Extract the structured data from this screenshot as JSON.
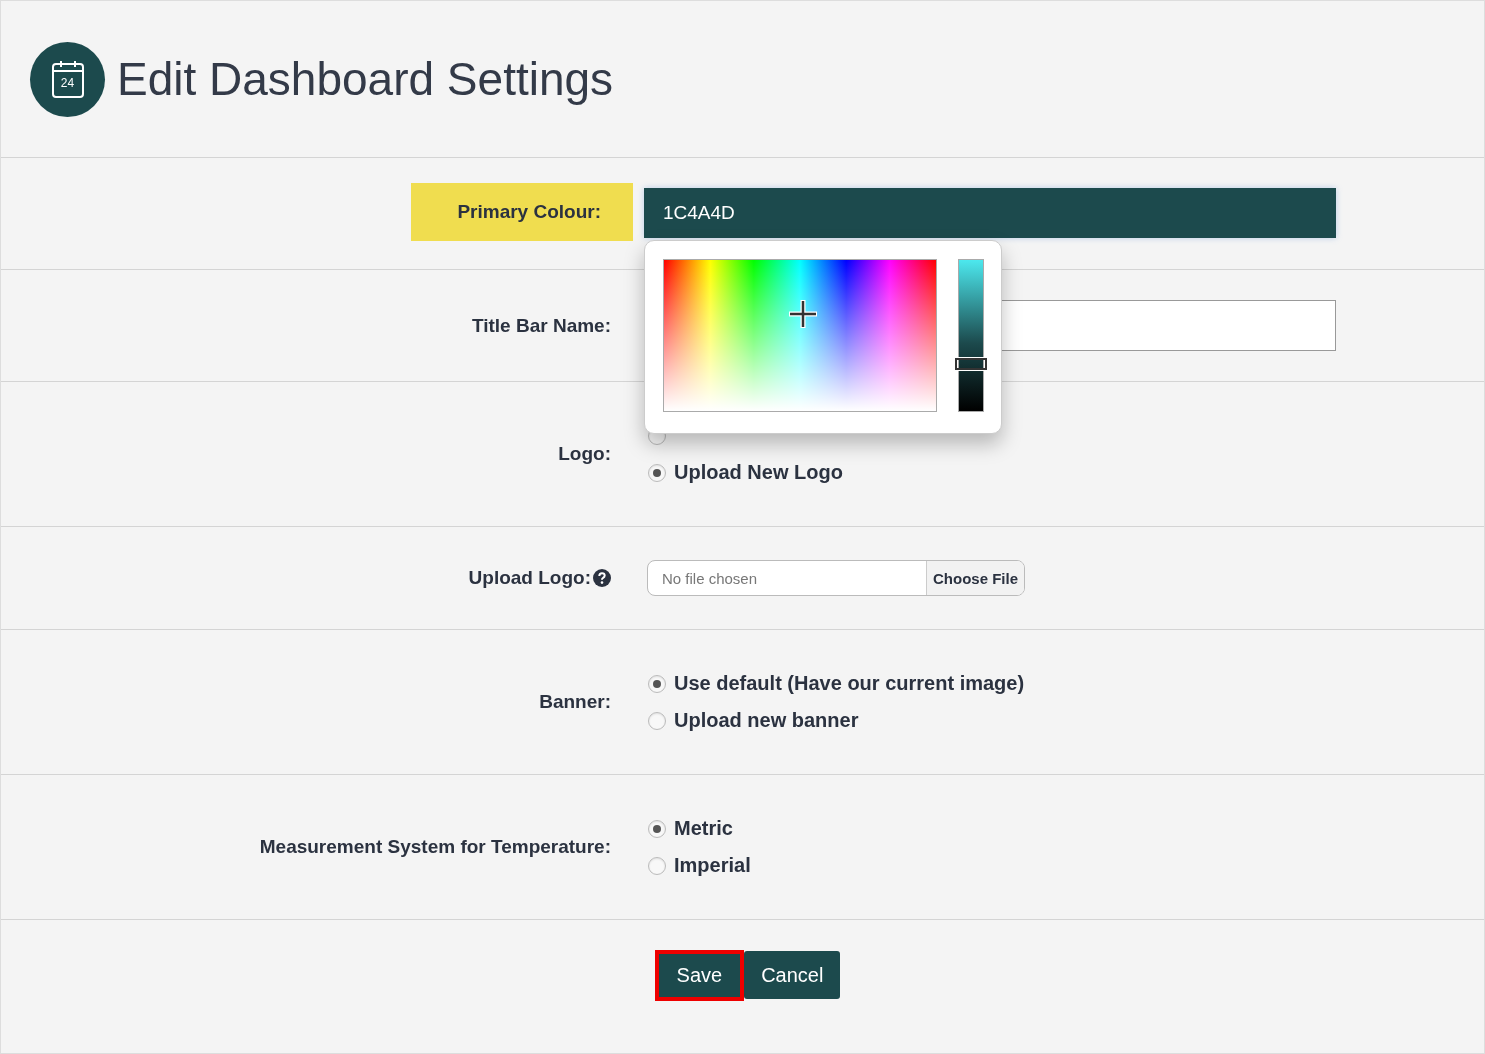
{
  "header": {
    "title": "Edit Dashboard Settings",
    "icon_text": "24"
  },
  "fields": [
    {
      "kind": "color",
      "label": "Primary Colour:",
      "highlighted": true,
      "value": "1C4A4D",
      "picker": {
        "open": true,
        "level": 0.31
      }
    },
    {
      "kind": "text",
      "label": "Title Bar Name:",
      "highlighted": false
    },
    {
      "kind": "radio",
      "label": "Logo:",
      "highlighted": false,
      "options": [
        {
          "selected": false
        },
        {
          "label": "Upload New Logo",
          "selected": true
        }
      ]
    },
    {
      "kind": "file",
      "label": "Upload Logo:",
      "help": true,
      "highlighted": false,
      "file_text": "No file chosen",
      "button": "Choose File"
    },
    {
      "kind": "radio",
      "label": "Banner:",
      "highlighted": false,
      "options": [
        {
          "label": "Use default (Have our current image)",
          "selected": true
        },
        {
          "label": "Upload new banner",
          "selected": false
        }
      ]
    },
    {
      "kind": "radio",
      "label": "Measurement System for Temperature:",
      "highlighted": false,
      "options": [
        {
          "label": "Metric",
          "selected": true
        },
        {
          "label": "Imperial",
          "selected": false
        }
      ]
    }
  ],
  "buttons": [
    {
      "label": "Save",
      "focused": true
    },
    {
      "label": "Cancel",
      "focused": false
    }
  ]
}
